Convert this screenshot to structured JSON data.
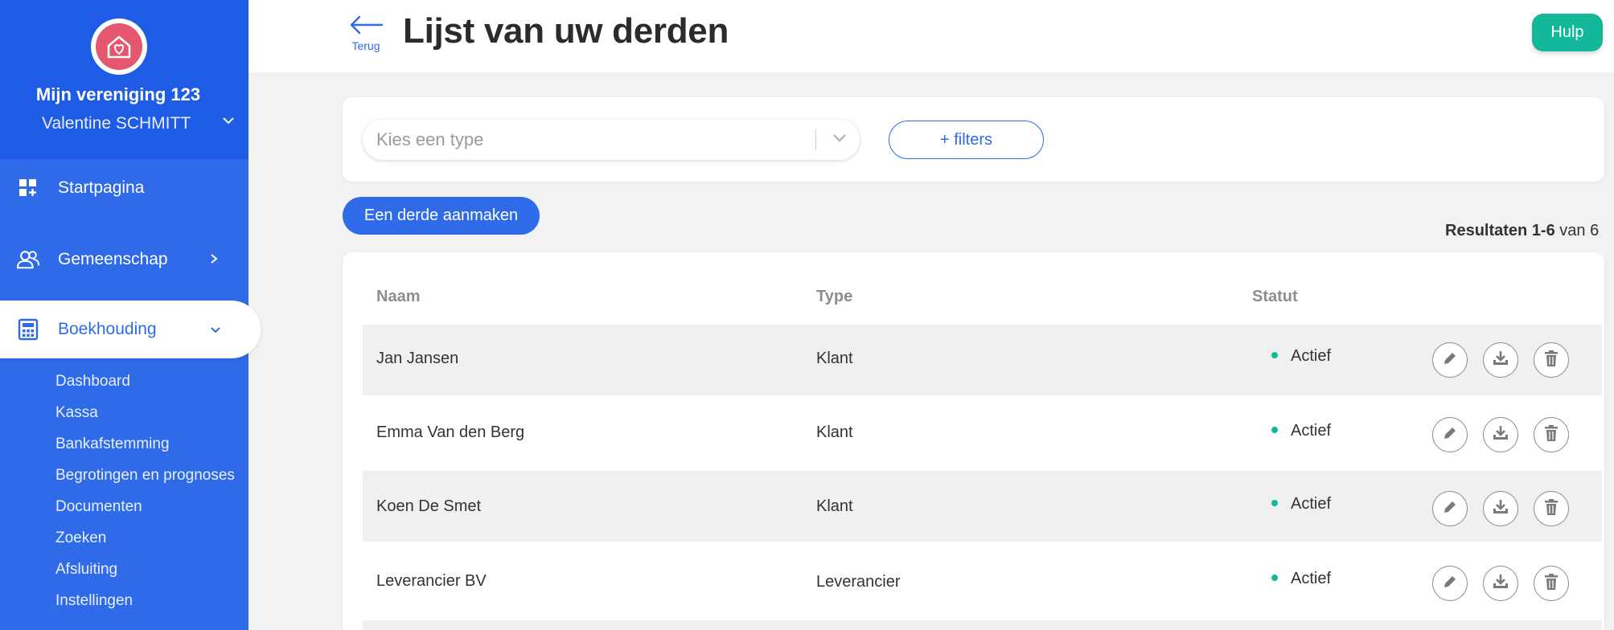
{
  "app": {
    "org_name": "Mijn vereniging 123",
    "user_name": "Valentine SCHMITT"
  },
  "sidebar": {
    "items": [
      {
        "label": "Startpagina",
        "icon": "dashboard-icon"
      },
      {
        "label": "Gemeenschap",
        "icon": "users-icon"
      },
      {
        "label": "Boekhouding",
        "icon": "calculator-icon",
        "active": true
      }
    ],
    "subitems": [
      "Dashboard",
      "Kassa",
      "Bankafstemming",
      "Begrotingen en prognoses",
      "Documenten",
      "Zoeken",
      "Afsluiting",
      "Instellingen"
    ]
  },
  "header": {
    "back_label": "Terug",
    "title": "Lijst van uw derden",
    "help_label": "Hulp"
  },
  "filters": {
    "type_placeholder": "Kies een type",
    "filters_label": "+ filters"
  },
  "create_label": "Een derde aanmaken",
  "results": {
    "prefix": "Resultaten",
    "range": "1-6",
    "suffix": "van 6"
  },
  "table": {
    "columns": [
      "Naam",
      "Type",
      "Statut"
    ],
    "rows": [
      {
        "name": "Jan Jansen",
        "type": "Klant",
        "status": "Actief"
      },
      {
        "name": "Emma Van den Berg",
        "type": "Klant",
        "status": "Actief"
      },
      {
        "name": "Koen De Smet",
        "type": "Klant",
        "status": "Actief"
      },
      {
        "name": "Leverancier BV",
        "type": "Leverancier",
        "status": "Actief"
      }
    ]
  },
  "colors": {
    "primary": "#2f6be9",
    "sidebar_top": "#1f5ce6",
    "accent_green": "#13b79a",
    "logo_pink": "#e5576e"
  }
}
